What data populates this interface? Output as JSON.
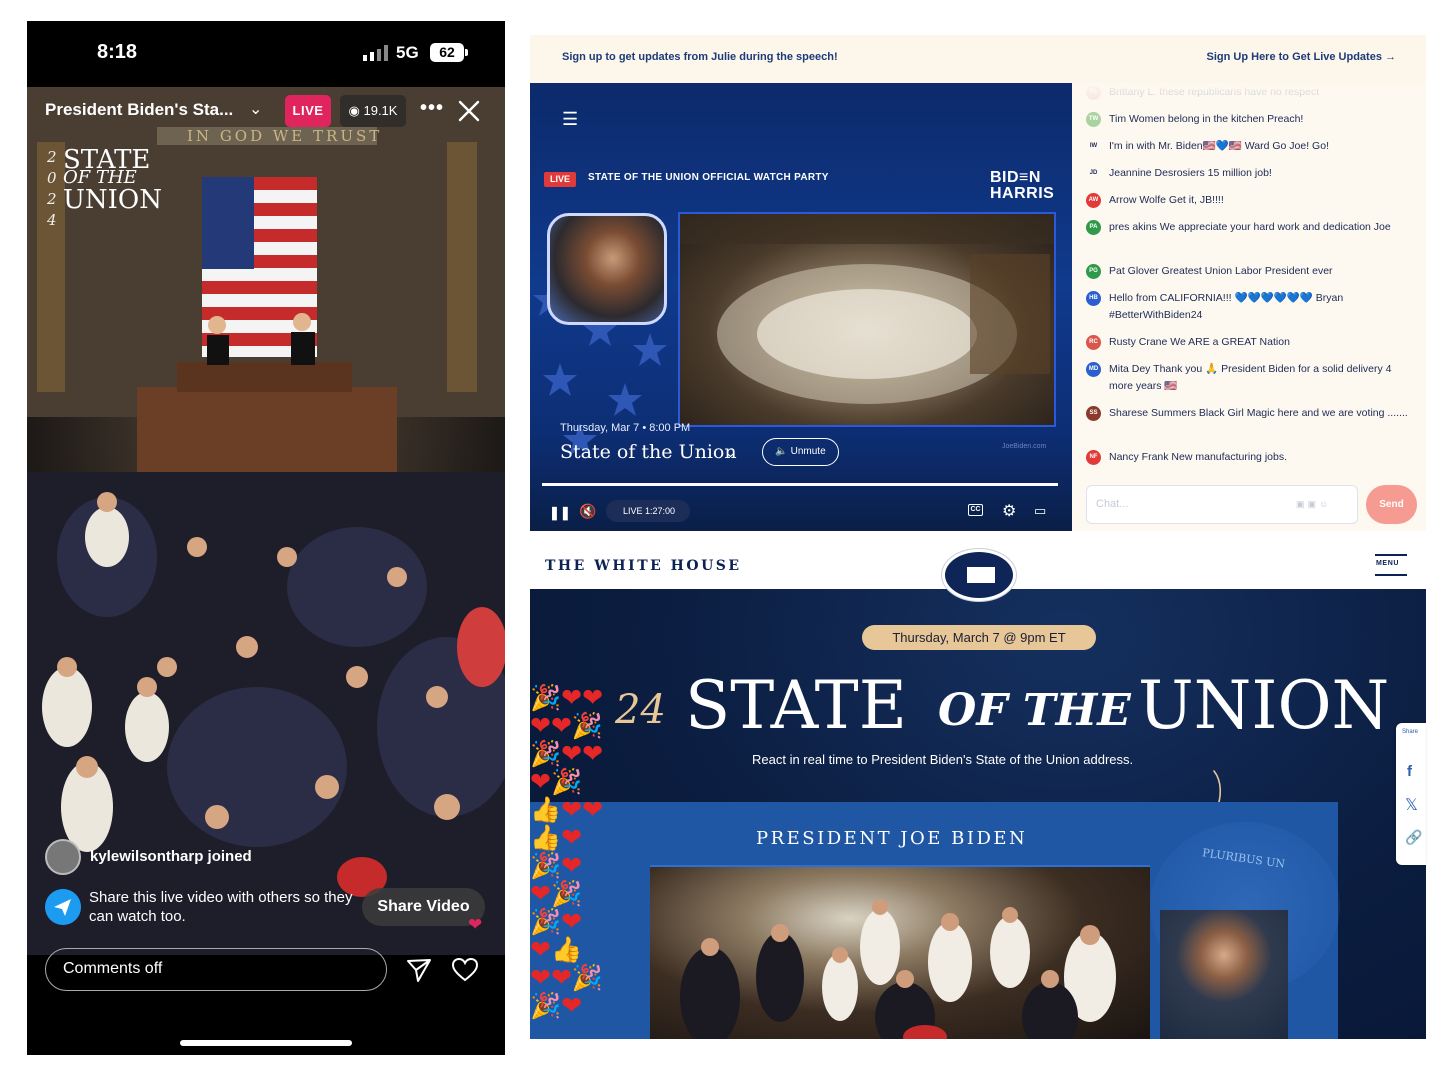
{
  "phone": {
    "status": {
      "time": "8:18",
      "network": "5G",
      "battery": "62"
    },
    "header": {
      "title": "President Biden's Sta...",
      "live_badge": "LIVE",
      "viewer_count": "19.1K",
      "more": "•••"
    },
    "video": {
      "sotu_years": [
        "2",
        "0",
        "2",
        "4"
      ],
      "sotu_line1": "STATE",
      "sotu_line2": "OF THE",
      "sotu_line3": "UNION",
      "motto": "IN GOD WE TRUST"
    },
    "join_notice": "kylewilsonthar​p joined",
    "share_prompt": "Share this live video with others so they can watch too.",
    "share_button": "Share Video",
    "comments_placeholder": "Comments off",
    "colors": {
      "live": "#e0245e",
      "share_icon": "#1d9bf0"
    }
  },
  "watch_party": {
    "banner": {
      "left": "Sign up to get updates from Julie during the speech!",
      "right": "Sign Up Here to Get Live Updates →"
    },
    "player": {
      "live_badge": "LIVE",
      "party_title": "STATE OF THE UNION OFFICIAL WATCH PARTY",
      "brand_line1": "BID≡N",
      "brand_line2": "HARRIS",
      "date_time": "Thursday, Mar 7 • 8:00 PM",
      "event_title": "State of the Union",
      "unmute": "Unmute",
      "watermark": "JoeBiden.com",
      "live_time": "LIVE 1:27:00",
      "cc": "CC"
    },
    "chat": {
      "messages": [
        {
          "initials": "BL",
          "color": "#e8b9b0",
          "text": "Brittany L.  these republicans have no respect"
        },
        {
          "initials": "TW",
          "color": "#a9d3a0",
          "text": "Tim Women belong in the kitchen  Preach!"
        },
        {
          "initials": "IW",
          "color": "#fdf8f0",
          "text": "I'm in with Mr. Biden🇺🇸💙🇺🇸 Ward  Go Joe! Go!"
        },
        {
          "initials": "JD",
          "color": "#fdf8f0",
          "text": "Jeannine Desrosiers  15 million job!"
        },
        {
          "initials": "AW",
          "color": "#e03a3a",
          "text": "Arrow Wolfe  Get it, JB!!!!"
        },
        {
          "initials": "PA",
          "color": "#2e9a4a",
          "text": "pres akins  We appreciate your hard work and dedication Joe"
        },
        {
          "initials": "PG",
          "color": "#2e9a4a",
          "text": "Pat Glover  Greatest Union Labor President ever"
        },
        {
          "initials": "HB",
          "color": "#2b5fcf",
          "text": "Hello from CALIFORNIA!!! 💙💙💙💙💙💙 Bryan #BetterWithBiden24"
        },
        {
          "initials": "RC",
          "color": "#d8564b",
          "text": "Rusty Crane  We ARE a GREAT Nation"
        },
        {
          "initials": "MD",
          "color": "#2b5fcf",
          "text": "Mita Dey  Thank you 🙏 President Biden for a solid delivery 4 more years 🇺🇸"
        },
        {
          "initials": "SS",
          "color": "#8a3b2c",
          "text": "Sharese Summers  Black Girl Magic here and we are voting ......."
        },
        {
          "initials": "NF",
          "color": "#e03a3a",
          "text": "Nancy Frank  New manufacturing jobs."
        }
      ],
      "input_placeholder": "Chat...",
      "send": "Send"
    }
  },
  "white_house": {
    "logo_text": "THE WHITE HOUSE",
    "menu": "MENU",
    "date_pill": "Thursday, March 7 @ 9pm ET",
    "headline_year": "24",
    "headline_state": "STATE",
    "headline_of_the": "OF THE",
    "headline_union": "UNION",
    "subtitle": "React in real time to President Biden's State of the Union address.",
    "panel_title": "PRESIDENT JOE BIDEN",
    "seal_motto": "PLURIBUS UN",
    "share": {
      "label": "Share",
      "facebook": "f",
      "x": "𝕏",
      "link": "🔗"
    },
    "colors": {
      "navy": "#0b1d40",
      "gold": "#e7c797",
      "panel_blue": "#1f57a5"
    }
  }
}
